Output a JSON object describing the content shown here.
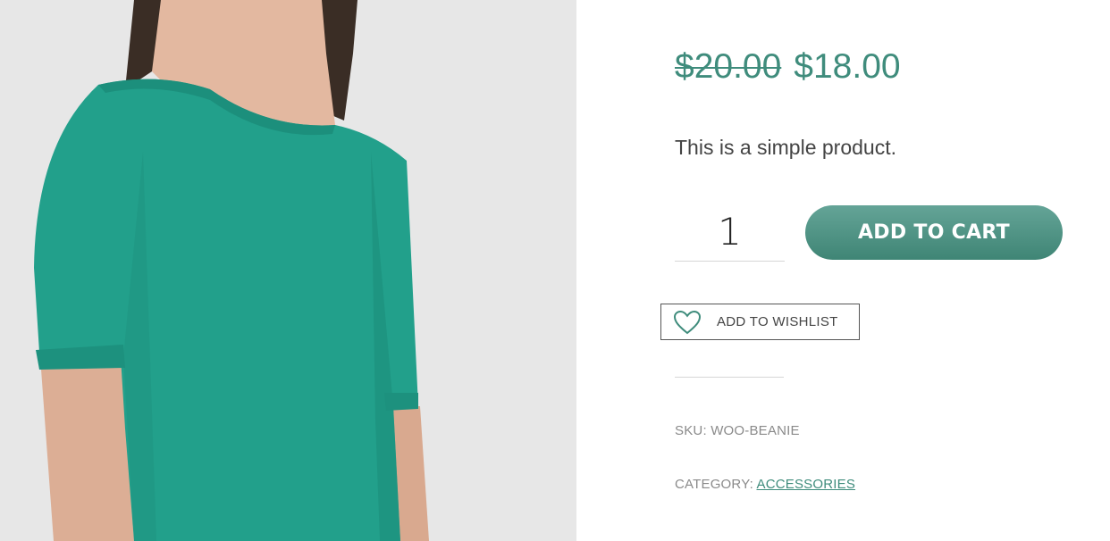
{
  "product": {
    "image_alt": "Woman wearing teal half-sleeve top",
    "price": {
      "regular": "$20.00",
      "sale": "$18.00"
    },
    "short_description": "This is a simple product.",
    "quantity": "1",
    "add_to_cart_label": "ADD TO CART",
    "wishlist_label": "ADD TO WISHLIST",
    "meta": {
      "sku_label": "SKU:",
      "sku_value": "WOO-BEANIE",
      "category_label": "CATEGORY:",
      "category_value": "ACCESSORIES"
    }
  },
  "colors": {
    "accent": "#3f8c7c",
    "shirt": "#24a08c",
    "image_bg": "#e6e6e6"
  },
  "icons": {
    "wishlist": "heart-icon"
  }
}
